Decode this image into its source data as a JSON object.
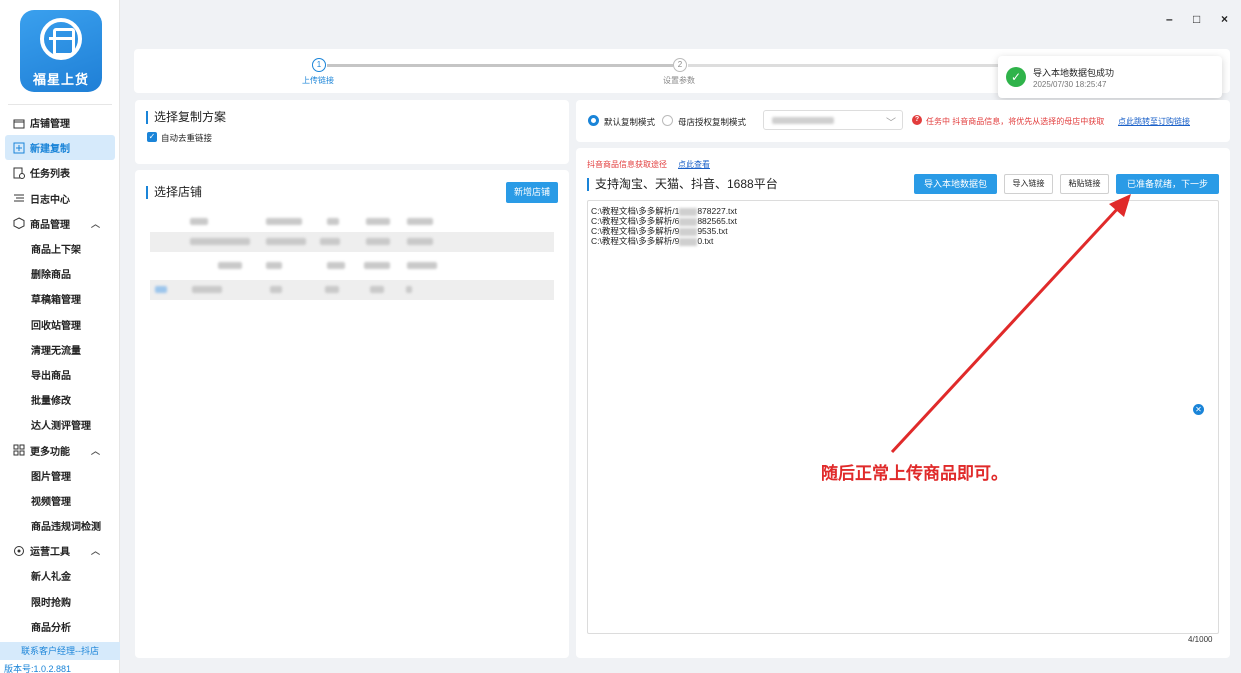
{
  "sidebar": {
    "logo_text": "福星上货",
    "items": [
      {
        "label": "店铺管理",
        "icon": "shop-icon"
      },
      {
        "label": "新建复制",
        "icon": "plus-square-icon"
      },
      {
        "label": "任务列表",
        "icon": "task-list-icon"
      },
      {
        "label": "日志中心",
        "icon": "log-icon"
      },
      {
        "label": "商品管理",
        "icon": "cube-icon"
      },
      {
        "label": "商品上下架"
      },
      {
        "label": "删除商品"
      },
      {
        "label": "草稿箱管理"
      },
      {
        "label": "回收站管理"
      },
      {
        "label": "清理无流量"
      },
      {
        "label": "导出商品"
      },
      {
        "label": "批量修改"
      },
      {
        "label": "达人测评管理"
      },
      {
        "label": "更多功能",
        "icon": "grid-icon"
      },
      {
        "label": "图片管理"
      },
      {
        "label": "视频管理"
      },
      {
        "label": "商品违规词检测"
      },
      {
        "label": "运营工具",
        "icon": "tools-icon"
      },
      {
        "label": "新人礼金"
      },
      {
        "label": "限时抢购"
      },
      {
        "label": "商品分析"
      }
    ],
    "contact": "联系客户经理--抖店",
    "version": "版本号:1.0.2.881"
  },
  "window": {
    "minimize": "–",
    "maximize": "□",
    "close": "×"
  },
  "steps": [
    {
      "number": "1",
      "label": "上传链接"
    },
    {
      "number": "2",
      "label": "设置参数"
    }
  ],
  "toast": {
    "title": "导入本地数据包成功",
    "time": "2025/07/30 18:25:47"
  },
  "scheme": {
    "title": "选择复制方案",
    "dedupe_label": "自动去重链接"
  },
  "shop": {
    "title": "选择店铺",
    "add_button": "新增店铺"
  },
  "mode": {
    "default_label": "默认复制模式",
    "auth_label": "母店授权复制模式",
    "warning": "任务中 抖音商品信息，将优先从选择的母店中获取",
    "warning_link": "点此跳转至订购链接"
  },
  "source": {
    "red_label": "抖音商品信息获取途径",
    "view_link": "点此查看",
    "platforms": "支持淘宝、天猫、抖音、1688平台",
    "import_pkg": "导入本地数据包",
    "import_link": "导入链接",
    "paste_link": "粘贴链接",
    "next": "已准备就绪，下一步"
  },
  "files": [
    {
      "prefix": "C:\\教程文档\\多多解析/1",
      "suffix": "878227.txt"
    },
    {
      "prefix": "C:\\教程文档\\多多解析/6",
      "suffix": "882565.txt"
    },
    {
      "prefix": "C:\\教程文档\\多多解析/9",
      "suffix": "9535.txt"
    },
    {
      "prefix": "C:\\教程文档\\多多解析/9",
      "suffix": "0.txt"
    }
  ],
  "counter": "4/1000",
  "annotation": "随后正常上传商品即可。",
  "colors": {
    "accent": "#1a84d8",
    "button": "#2a9be6",
    "annotation": "#e02a2a",
    "success": "#2fb34a"
  }
}
